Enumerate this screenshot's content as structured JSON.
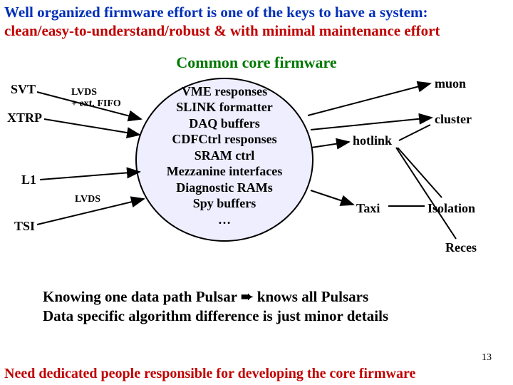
{
  "title": {
    "line1": "Well organized firmware effort is one of the keys to have a system:",
    "line2": "clean/easy-to-understand/robust & with minimal maintenance effort"
  },
  "subtitle": "Common core firmware",
  "ellipse_lines": {
    "l1": "VME responses",
    "l2": "SLINK formatter",
    "l3": "DAQ buffers",
    "l4": "CDFCtrl responses",
    "l5": "SRAM ctrl",
    "l6": "Mezzanine interfaces",
    "l7": "Diagnostic RAMs",
    "l8": "Spy buffers",
    "l9": "…"
  },
  "left_labels": {
    "svt": "SVT",
    "xtrp": "XTRP",
    "l1": "L1",
    "tsi": "TSI"
  },
  "left_small": {
    "lvds_fifo_a": "LVDS",
    "lvds_fifo_b": "+ ext. FIFO",
    "lvds": "LVDS"
  },
  "right_labels": {
    "muon": "muon",
    "cluster": "cluster",
    "hotlink": "hotlink",
    "taxi": "Taxi",
    "isolation": "Isolation",
    "reces": "Reces"
  },
  "bottom": {
    "line1a": "Knowing one data path Pulsar ",
    "arrow": "➨",
    "line1b": " knows all Pulsars",
    "line2": "Data specific algorithm difference is just minor details"
  },
  "pagenum": "13",
  "footer": "Need dedicated people responsible for developing the core firmware"
}
